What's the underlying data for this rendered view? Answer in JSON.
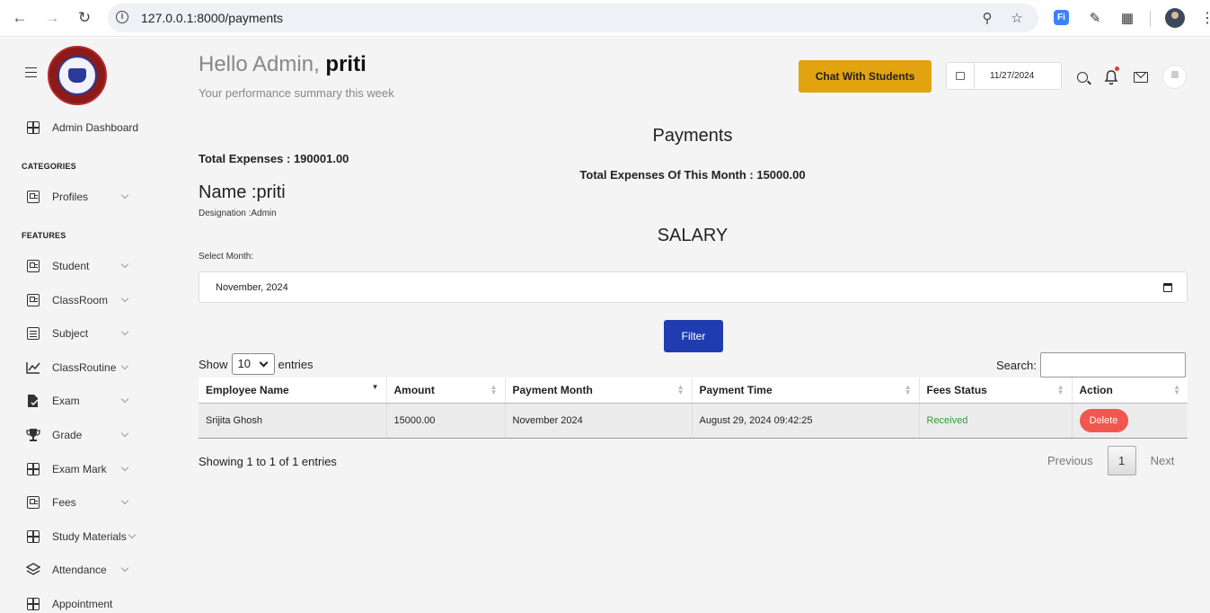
{
  "browser": {
    "url": "127.0.0.1:8000/payments",
    "ext_fi_label": "Fi"
  },
  "sidebar": {
    "categories_label": "CATEGORIES",
    "features_label": "FEATURES",
    "dashboard": "Admin Dashboard",
    "profiles": "Profiles",
    "items": [
      {
        "label": "Student"
      },
      {
        "label": "ClassRoom"
      },
      {
        "label": "Subject"
      },
      {
        "label": "ClassRoutine"
      },
      {
        "label": "Exam"
      },
      {
        "label": "Grade"
      },
      {
        "label": "Exam Mark"
      },
      {
        "label": "Fees"
      },
      {
        "label": "Study Materials"
      },
      {
        "label": "Attendance"
      },
      {
        "label": "Appointment"
      }
    ]
  },
  "header": {
    "greeting_prefix": "Hello Admin,",
    "greeting_name": "priti",
    "subtitle": "Your performance summary this week",
    "chat_button": "Chat With Students",
    "date": "11/27/2024"
  },
  "main": {
    "title": "Payments",
    "total_expenses": "Total Expenses : 190001.00",
    "total_month": "Total Expenses Of This Month : 15000.00",
    "name": "Name :priti",
    "designation": "Designation :Admin",
    "salary_title": "SALARY",
    "select_month_label": "Select Month:",
    "month_value": "November, 2024",
    "filter_button": "Filter"
  },
  "table": {
    "show_label": "Show",
    "entries_label": "entries",
    "page_size": "10",
    "search_label": "Search:",
    "columns": [
      "Employee Name",
      "Amount",
      "Payment Month",
      "Payment Time",
      "Fees Status",
      "Action"
    ],
    "rows": [
      {
        "employee": "Srijita Ghosh",
        "amount": "15000.00",
        "month": "November 2024",
        "time": "August 29, 2024 09:42:25",
        "status": "Received",
        "action": "Delete"
      }
    ],
    "info": "Showing 1 to 1 of 1 entries",
    "prev": "Previous",
    "page": "1",
    "next": "Next"
  }
}
